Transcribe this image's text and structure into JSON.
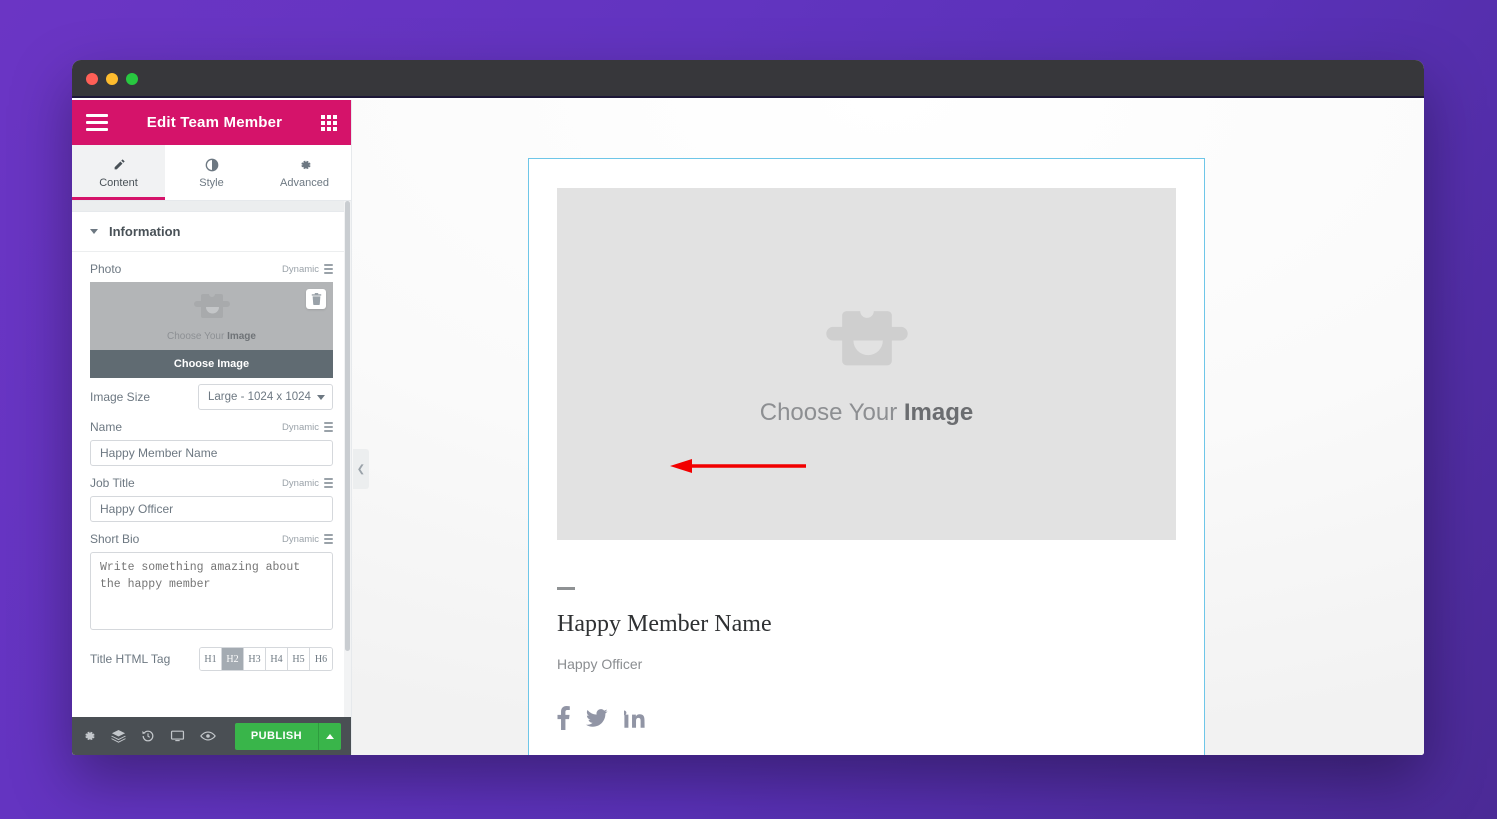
{
  "window": {
    "traffic_lights": [
      "close",
      "minimize",
      "maximize"
    ]
  },
  "panel": {
    "header": {
      "title": "Edit Team Member",
      "menu_icon": "hamburger-icon",
      "apps_icon": "grid-icon"
    },
    "tabs": [
      {
        "label": "Content",
        "icon": "pencil-icon",
        "active": true
      },
      {
        "label": "Style",
        "icon": "contrast-icon",
        "active": false
      },
      {
        "label": "Advanced",
        "icon": "gear-icon",
        "active": false
      }
    ],
    "section": {
      "title": "Information",
      "expanded": true
    },
    "controls": {
      "photo": {
        "label": "Photo",
        "dynamic_label": "Dynamic",
        "placeholder_caption_light": "Choose Your ",
        "placeholder_caption_bold": "Image",
        "button_label": "Choose Image",
        "delete_icon": "trash-icon"
      },
      "image_size": {
        "label": "Image Size",
        "value": "Large - 1024 x 1024"
      },
      "name": {
        "label": "Name",
        "dynamic_label": "Dynamic",
        "value": "Happy Member Name"
      },
      "job_title": {
        "label": "Job Title",
        "dynamic_label": "Dynamic",
        "value": "Happy Officer"
      },
      "short_bio": {
        "label": "Short Bio",
        "dynamic_label": "Dynamic",
        "value": "",
        "placeholder": "Write something amazing about the happy member"
      },
      "title_html_tag": {
        "label": "Title HTML Tag",
        "options": [
          "H1",
          "H2",
          "H3",
          "H4",
          "H5",
          "H6"
        ],
        "selected": "H2"
      }
    },
    "footer": {
      "icons": [
        "gear-icon",
        "layers-icon",
        "history-icon",
        "responsive-icon",
        "preview-icon"
      ],
      "publish_label": "PUBLISH",
      "publish_color": "#39b54a",
      "publish_dropdown_icon": "caret-up-icon"
    },
    "collapse_handle_icon": "chevron-left-icon"
  },
  "canvas": {
    "widget": {
      "selected_border_color": "#6ec6e8",
      "image_placeholder": {
        "caption_light": "Choose Your ",
        "caption_bold": "Image",
        "icon": "image-placeholder-icon"
      },
      "divider": "—",
      "name": "Happy Member Name",
      "job_title": "Happy Officer",
      "social_icons": [
        "facebook-icon",
        "twitter-icon",
        "linkedin-icon"
      ]
    }
  },
  "annotation": {
    "arrow_color": "#f20000",
    "points_to": "choose-image-button"
  },
  "theme": {
    "accent_pink": "#d5136a",
    "background_purple": "#6234c0"
  }
}
